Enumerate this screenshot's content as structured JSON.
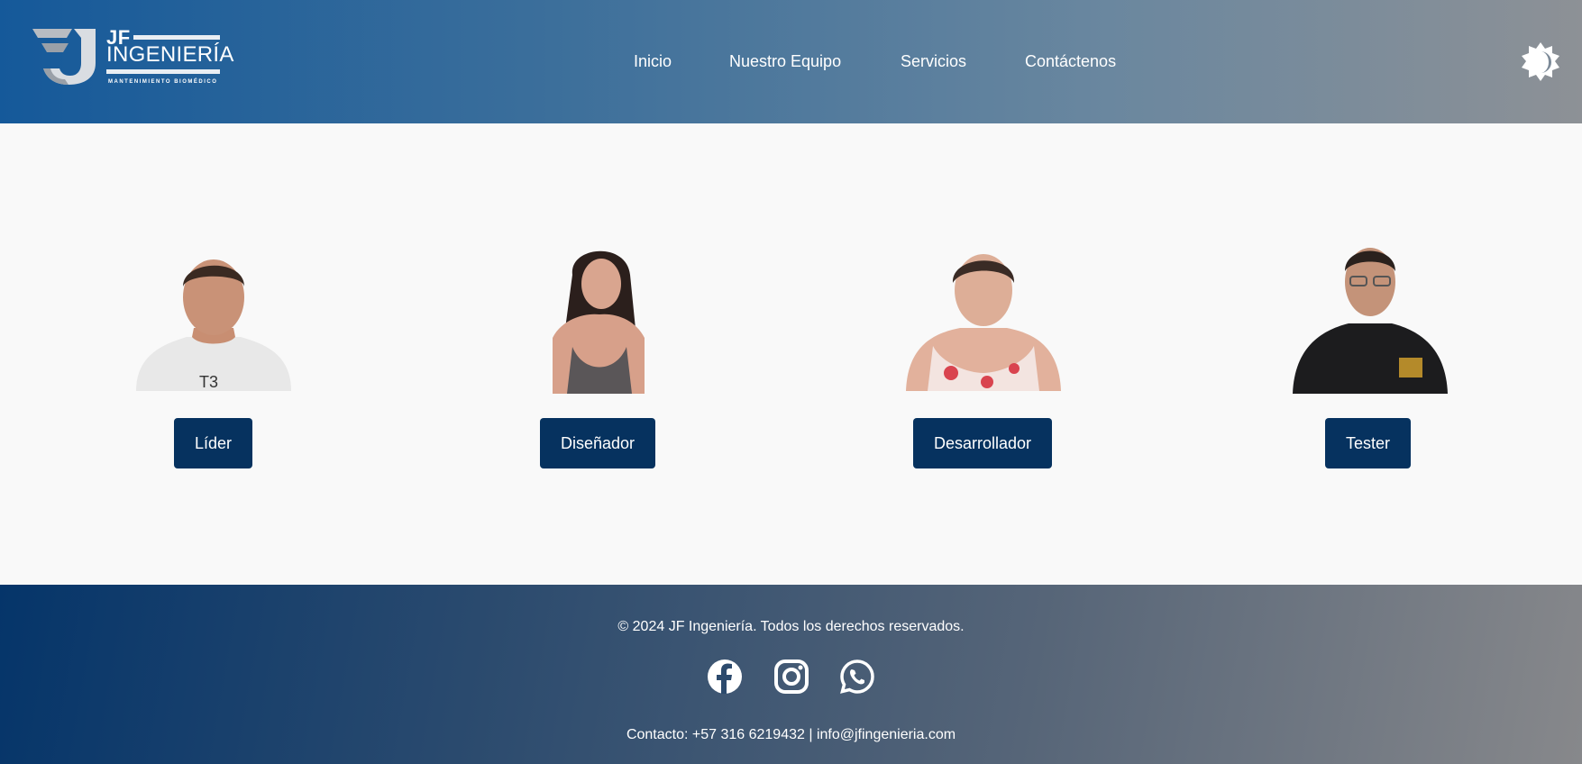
{
  "header": {
    "logo": {
      "mark": "JF",
      "name": "INGENIERÍA",
      "tagline": "MANTENIMIENTO BIOMÉDICO"
    },
    "nav": [
      {
        "label": "Inicio"
      },
      {
        "label": "Nuestro Equipo"
      },
      {
        "label": "Servicios"
      },
      {
        "label": "Contáctenos"
      }
    ],
    "theme_toggle_icon": "sun-moon-icon"
  },
  "team": [
    {
      "role": "Líder",
      "icon": "person-photo"
    },
    {
      "role": "Diseñador",
      "icon": "person-photo"
    },
    {
      "role": "Desarrollador",
      "icon": "person-photo"
    },
    {
      "role": "Tester",
      "icon": "person-photo"
    }
  ],
  "footer": {
    "copyright": "© 2024 JF Ingeniería. Todos los derechos reservados.",
    "social": [
      {
        "icon": "facebook-icon"
      },
      {
        "icon": "instagram-icon"
      },
      {
        "icon": "whatsapp-icon"
      }
    ],
    "contact": "Contacto: +57 316 6219432 | info@jfingenieria.com"
  },
  "colors": {
    "header_start": "#15599a",
    "header_end": "#8d9196",
    "button_bg": "#06325f",
    "footer_start": "#05356a",
    "footer_end": "#87888b",
    "main_bg": "#f9f9f9"
  }
}
